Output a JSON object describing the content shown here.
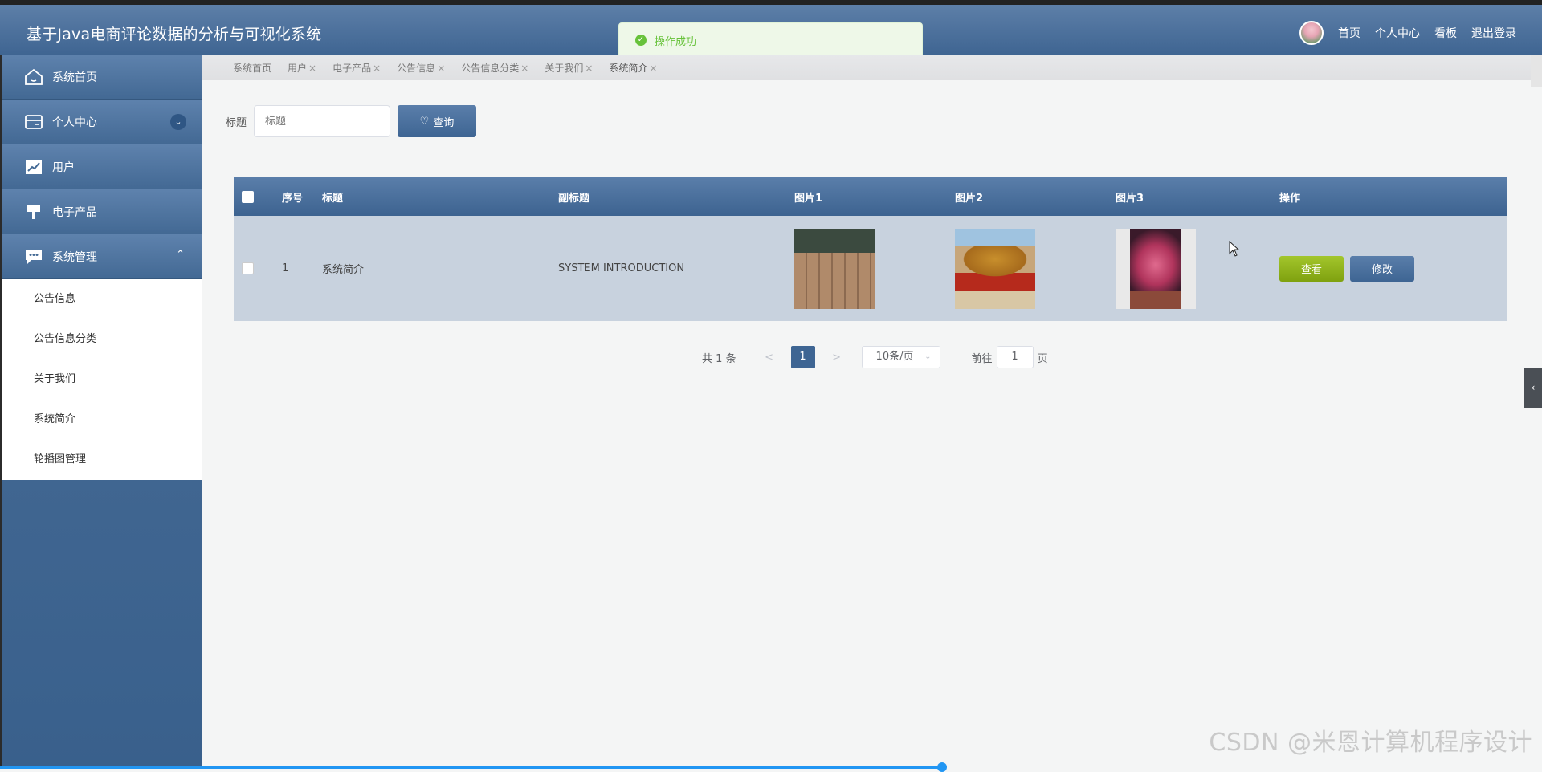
{
  "app": {
    "title": "基于Java电商评论数据的分析与可视化系统"
  },
  "topnav": {
    "home": "首页",
    "profile": "个人中心",
    "board": "看板",
    "logout": "退出登录"
  },
  "toast": {
    "message": "操作成功"
  },
  "sidebar": {
    "items": [
      {
        "label": "系统首页",
        "icon": "home-icon"
      },
      {
        "label": "个人中心",
        "icon": "card-icon"
      },
      {
        "label": "用户",
        "icon": "chart-line-icon"
      },
      {
        "label": "电子产品",
        "icon": "brush-icon"
      },
      {
        "label": "系统管理",
        "icon": "chat-icon"
      }
    ],
    "submenu": [
      "公告信息",
      "公告信息分类",
      "关于我们",
      "系统简介",
      "轮播图管理"
    ]
  },
  "tabs": [
    "系统首页",
    "用户",
    "电子产品",
    "公告信息",
    "公告信息分类",
    "关于我们",
    "系统简介"
  ],
  "search": {
    "label": "标题",
    "placeholder": "标题",
    "button": "查询"
  },
  "table": {
    "headers": [
      "序号",
      "标题",
      "副标题",
      "图片1",
      "图片2",
      "图片3",
      "操作"
    ],
    "rows": [
      {
        "no": "1",
        "title": "系统简介",
        "subtitle": "SYSTEM INTRODUCTION",
        "view": "查看",
        "edit": "修改"
      }
    ]
  },
  "pagination": {
    "total": "共 1 条",
    "page": "1",
    "page_size": "10条/页",
    "goto": "前往",
    "goto_value": "1",
    "page_suffix": "页"
  },
  "watermark": "CSDN @米恩计算机程序设计",
  "colors": {
    "primary": "#3e6593",
    "success": "#67c23a",
    "view_button": "#8db11a"
  }
}
